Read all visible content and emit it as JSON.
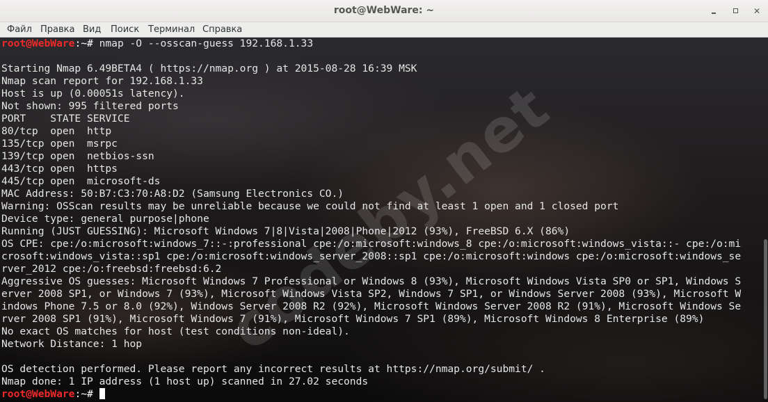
{
  "window": {
    "title": "root@WebWare: ~",
    "minimize_icon": "minimize-icon",
    "maximize_icon": "maximize-icon",
    "close_icon": "close-icon",
    "close_glyph": "✕"
  },
  "menu": {
    "items": [
      "Файл",
      "Правка",
      "Вид",
      "Поиск",
      "Терминал",
      "Справка"
    ]
  },
  "watermark": "codeby.net",
  "prompt": {
    "user": "root@WebWare",
    "path": ":~# "
  },
  "terminal": {
    "command": "nmap -O --osscan-guess 192.168.1.33",
    "output": [
      "",
      "Starting Nmap 6.49BETA4 ( https://nmap.org ) at 2015-08-28 16:39 MSK",
      "Nmap scan report for 192.168.1.33",
      "Host is up (0.00051s latency).",
      "Not shown: 995 filtered ports",
      "PORT    STATE SERVICE",
      "80/tcp  open  http",
      "135/tcp open  msrpc",
      "139/tcp open  netbios-ssn",
      "443/tcp open  https",
      "445/tcp open  microsoft-ds",
      "MAC Address: 50:B7:C3:70:A8:D2 (Samsung Electronics CO.)",
      "Warning: OSScan results may be unreliable because we could not find at least 1 open and 1 closed port",
      "Device type: general purpose|phone",
      "Running (JUST GUESSING): Microsoft Windows 7|8|Vista|2008|Phone|2012 (93%), FreeBSD 6.X (86%)",
      "OS CPE: cpe:/o:microsoft:windows_7::-:professional cpe:/o:microsoft:windows_8 cpe:/o:microsoft:windows_vista::- cpe:/o:mi",
      "crosoft:windows_vista::sp1 cpe:/o:microsoft:windows_server_2008::sp1 cpe:/o:microsoft:windows cpe:/o:microsoft:windows_se",
      "rver_2012 cpe:/o:freebsd:freebsd:6.2",
      "Aggressive OS guesses: Microsoft Windows 7 Professional or Windows 8 (93%), Microsoft Windows Vista SP0 or SP1, Windows S",
      "erver 2008 SP1, or Windows 7 (93%), Microsoft Windows Vista SP2, Windows 7 SP1, or Windows Server 2008 (93%), Microsoft W",
      "indows Phone 7.5 or 8.0 (92%), Windows Server 2008 R2 (92%), Microsoft Windows Server 2008 R2 (91%), Microsoft Windows Se",
      "rver 2008 SP1 (91%), Microsoft Windows 7 (91%), Microsoft Windows 7 SP1 (89%), Microsoft Windows 8 Enterprise (89%)",
      "No exact OS matches for host (test conditions non-ideal).",
      "Network Distance: 1 hop",
      "",
      "OS detection performed. Please report any incorrect results at https://nmap.org/submit/ .",
      "Nmap done: 1 IP address (1 host up) scanned in 27.02 seconds"
    ]
  },
  "colors": {
    "prompt_user": "#ef2929",
    "text": "#e6e6e6",
    "titlebar": "#f2f1f0"
  }
}
